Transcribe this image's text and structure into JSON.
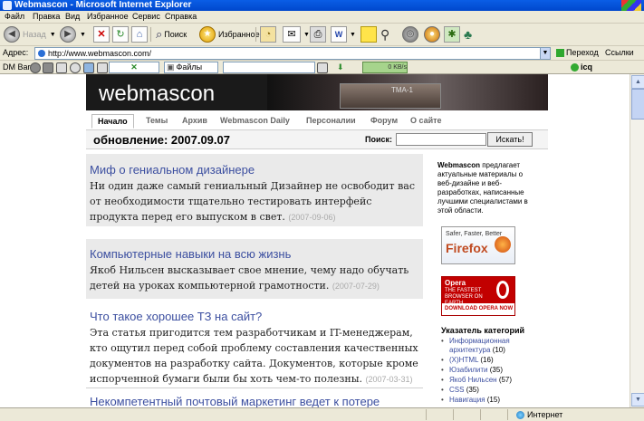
{
  "window": {
    "title": "Webmascon - Microsoft Internet Explorer"
  },
  "menu": [
    "Файл",
    "Правка",
    "Вид",
    "Избранное",
    "Сервис",
    "Справка"
  ],
  "toolbar": {
    "back": "Назад",
    "search": "Поиск",
    "favorites": "Избранное"
  },
  "address": {
    "label": "Адрес:",
    "url": "http://www.webmascon.com/",
    "go": "Переход",
    "links": "Ссылки"
  },
  "dmbar": {
    "label": "DM Bar",
    "files": "Файлы",
    "progress": "0 KB/s",
    "icq": "icq"
  },
  "site": {
    "logo": "webmascon",
    "banner_meter": "TMA-1",
    "nav": [
      "Начало",
      "Темы",
      "Архив",
      "Webmascon Daily",
      "Персоналии",
      "Форум",
      "О сайте"
    ],
    "update": "обновление: 2007.09.07",
    "search_label": "Поиск:",
    "search_button": "Искать!"
  },
  "articles": [
    {
      "title": "Миф о гениальном дизайнере",
      "body": "Ни один даже самый гениальный Дизайнер не освободит вас от необходимости тщательно тестировать интерфейс продукта перед его выпуском в свет.",
      "date": "(2007-09-06)"
    },
    {
      "title": "Компьютерные навыки на всю жизнь",
      "body": "Якоб Нильсен высказывает свое мнение, чему надо обучать детей на уроках компьютерной грамотности.",
      "date": "(2007-07-29)"
    },
    {
      "title": "Что такое хорошее ТЗ на сайт?",
      "body": "Эта статья пригодится тем разработчикам и IT-менеджерам, кто ощутил перед собой проблему составления качественных документов на разработку сайта. Документов, которые кроме испорченной бумаги были бы хоть чем-то полезны.",
      "date": "(2007-03-31)"
    },
    {
      "title": "Некомпетентный почтовый маркетинг ведет к потере"
    }
  ],
  "sidebar": {
    "brand": "Webmascon",
    "intro": " предлагает актуальные материалы о веб-дизайне и веб-разработках, написанные лучшими специалистами в этой области.",
    "firefox": {
      "tagline": "Safer, Faster, Better",
      "name": "Firefox"
    },
    "opera": {
      "name": "Opera",
      "tagline": "THE FASTEST BROWSER ON EARTH",
      "cta": "DOWNLOAD OPERA NOW"
    },
    "categories_title": "Указатель категорий",
    "categories": [
      {
        "name": "Информационная архитектура",
        "count": "(10)"
      },
      {
        "name": "(X)HTML",
        "count": "(16)"
      },
      {
        "name": "Юзабилити",
        "count": "(35)"
      },
      {
        "name": "Якоб Нильсен",
        "count": "(57)"
      },
      {
        "name": "CSS",
        "count": "(35)"
      },
      {
        "name": "Навигация",
        "count": "(15)"
      }
    ]
  },
  "status": {
    "zone": "Интернет"
  }
}
